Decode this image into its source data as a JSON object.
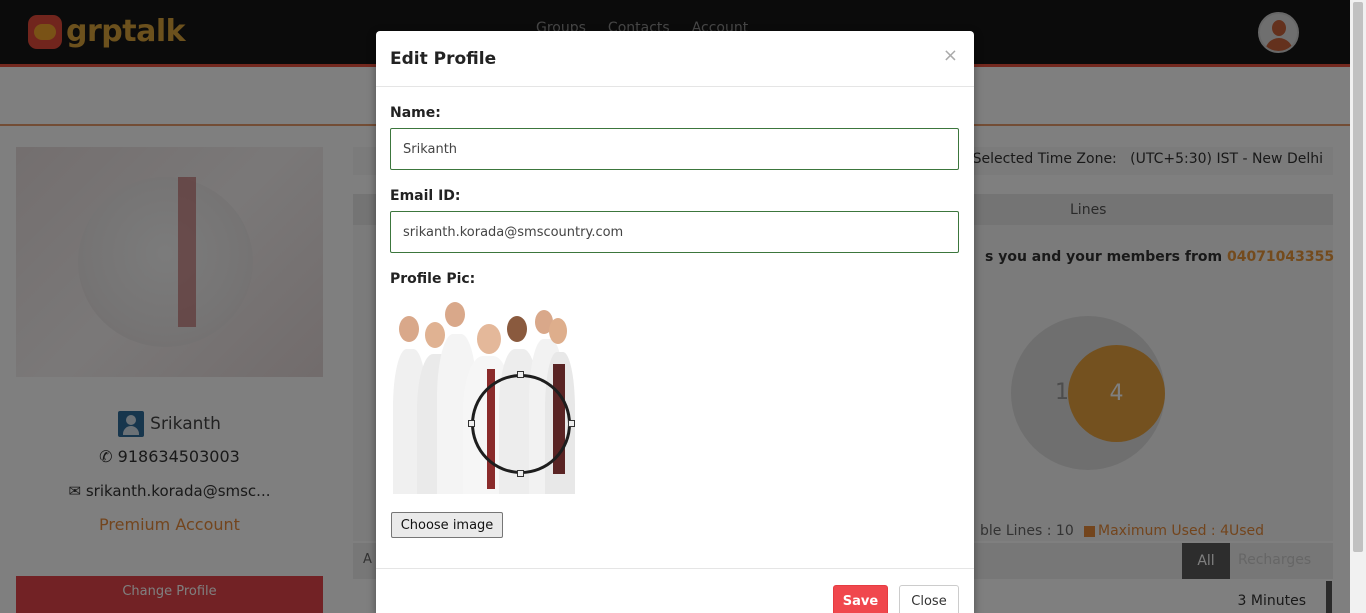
{
  "app": {
    "logo_text": "grptalk",
    "nav": [
      "Groups",
      "Contacts",
      "Account"
    ]
  },
  "profile": {
    "name": "Srikanth",
    "phone": "918634503003",
    "email": "srikanth.korada@smsc...",
    "account_type": "Premium Account",
    "change_profile_label": "Change Profile"
  },
  "dashboard": {
    "timezone_label": "Selected Time Zone:",
    "timezone_value": "(UTC+5:30) IST - New Delhi",
    "lines_header": "Lines",
    "lines_desc_prefix": "s you and your members from",
    "lines_number": "04071043355",
    "available_lines_value": "10",
    "max_used_value": "4",
    "legend_available": "ble Lines : 10",
    "legend_max": "Maximum Used : 4Used",
    "activity_label": "A",
    "tab_all": "All",
    "tab_recharges": "Recharges",
    "row_time": "3 Minutes",
    "colors": {
      "accent": "#e8a33e",
      "danger": "#f0474d",
      "brand_red": "#e24a3b"
    }
  },
  "modal": {
    "title": "Edit Profile",
    "close_symbol": "×",
    "name_label": "Name:",
    "name_value": "Srikanth",
    "email_label": "Email ID:",
    "email_value": "srikanth.korada@smscountry.com",
    "pic_label": "Profile Pic:",
    "choose_image_label": "Choose image",
    "save_label": "Save",
    "close_label": "Close"
  }
}
